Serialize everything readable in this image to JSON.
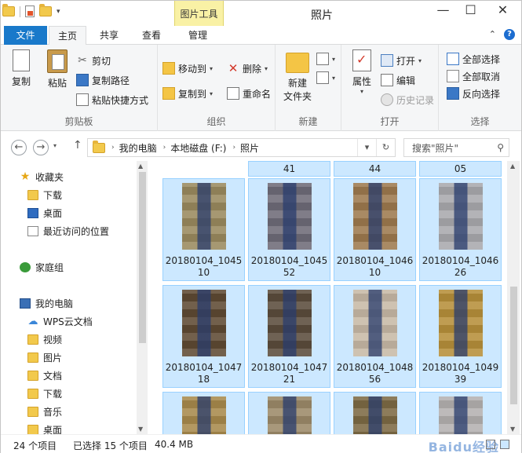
{
  "window": {
    "title": "照片",
    "context_tab": "图片工具",
    "buttons": {
      "minimize": "—",
      "maximize": "☐",
      "close": "✕"
    }
  },
  "tabs": [
    {
      "label": "文件"
    },
    {
      "label": "主页"
    },
    {
      "label": "共享"
    },
    {
      "label": "查看"
    },
    {
      "label": "管理"
    }
  ],
  "ribbon": {
    "clipboard": {
      "label": "剪贴板",
      "copy": "复制",
      "paste": "粘贴",
      "cut": "剪切",
      "copy_path": "复制路径",
      "paste_shortcut": "粘贴快捷方式"
    },
    "organize": {
      "label": "组织",
      "move_to": "移动到",
      "copy_to": "复制到",
      "delete": "删除",
      "rename": "重命名"
    },
    "new": {
      "label": "新建",
      "new_folder_line1": "新建",
      "new_folder_line2": "文件夹"
    },
    "open": {
      "label": "打开",
      "properties": "属性",
      "open": "打开",
      "edit": "编辑",
      "history": "历史记录"
    },
    "select": {
      "label": "选择",
      "select_all": "全部选择",
      "select_none": "全部取消",
      "invert": "反向选择"
    }
  },
  "address": {
    "crumbs": [
      "我的电脑",
      "本地磁盘 (F:)",
      "照片"
    ],
    "search_placeholder": "搜索\"照片\""
  },
  "nav": {
    "favorites": "收藏夹",
    "downloads": "下载",
    "desktop": "桌面",
    "recent": "最近访问的位置",
    "homegroup": "家庭组",
    "this_pc": "我的电脑",
    "wps": "WPS云文档",
    "videos": "视频",
    "pictures": "图片",
    "documents": "文档",
    "downloads2": "下载",
    "music": "音乐",
    "desktop2": "桌面"
  },
  "files": {
    "top_partial": [
      "41",
      "44",
      "05"
    ],
    "row1": [
      {
        "line1": "20180104_1045",
        "line2": "10"
      },
      {
        "line1": "20180104_1045",
        "line2": "52"
      },
      {
        "line1": "20180104_1046",
        "line2": "10"
      },
      {
        "line1": "20180104_1046",
        "line2": "26"
      }
    ],
    "row2": [
      {
        "line1": "20180104_1047",
        "line2": "18"
      },
      {
        "line1": "20180104_1047",
        "line2": "21"
      },
      {
        "line1": "20180104_1048",
        "line2": "56"
      },
      {
        "line1": "20180104_1049",
        "line2": "39"
      }
    ]
  },
  "status": {
    "count": "24 个项目",
    "selected": "已选择 15 个项目",
    "size": "40.4 MB",
    "watermark": "Baidu经验"
  },
  "colors": {
    "accent": "#1979ca",
    "selection_fill": "#cce8ff",
    "selection_border": "#99d1ff",
    "context_tab": "#f9f1a5"
  }
}
